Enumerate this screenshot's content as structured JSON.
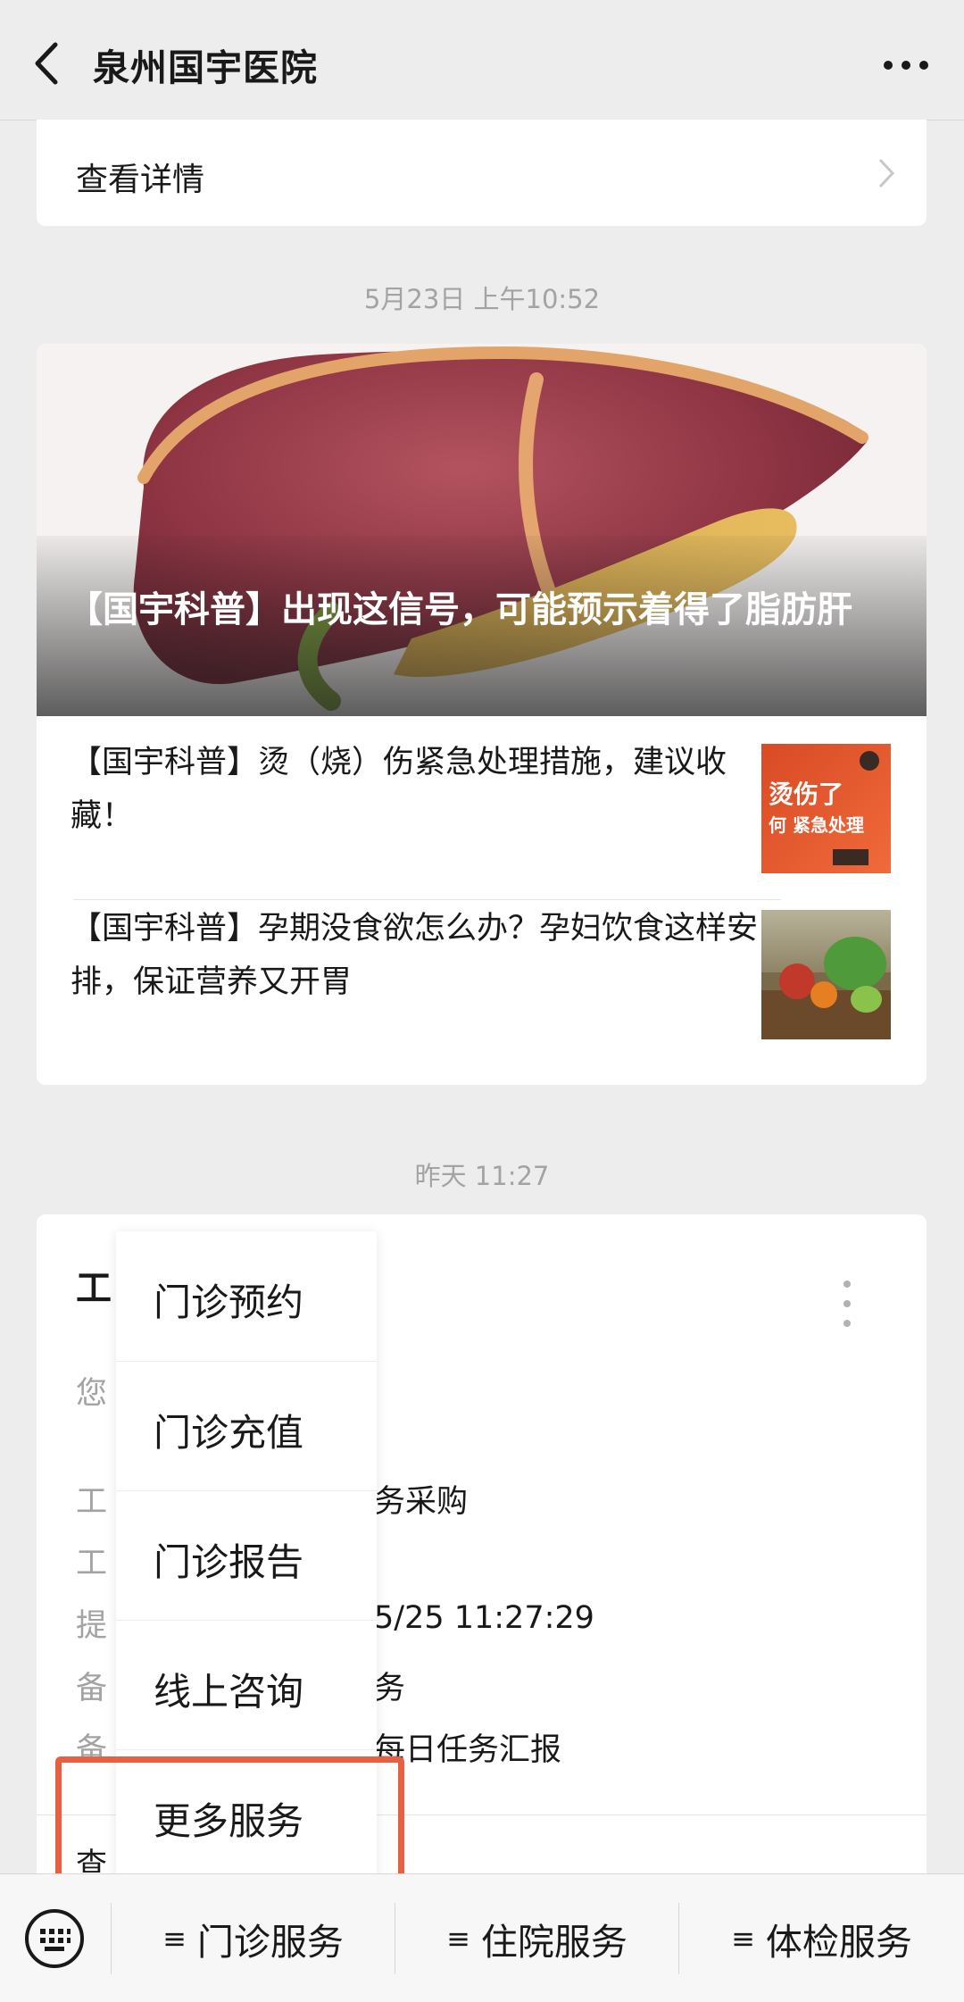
{
  "header": {
    "title": "泉州国宇医院",
    "back_icon": "chevron-left-icon",
    "more_icon": "more-dots-icon"
  },
  "card1": {
    "label": "查看详情"
  },
  "timestamps": {
    "first": "5月23日 上午10:52",
    "second": "昨天 11:27"
  },
  "articles": {
    "hero_title": "【国宇科普】出现这信号，可能预示着得了脂肪肝",
    "items": [
      {
        "title": "【国宇科普】烫（烧）伤紧急处理措施，建议收藏！",
        "thumb_line1": "烫伤了",
        "thumb_line2": "何 紧急处理"
      },
      {
        "title": "【国宇科普】孕期没食欲怎么办？孕妇饮食这样安排，保证营养又开胃"
      }
    ]
  },
  "template_msg": {
    "head_visible": "工",
    "rows": [
      {
        "left": "您",
        "right": ""
      },
      {
        "left": "工",
        "right": "务采购"
      },
      {
        "left": "工",
        "right": ""
      },
      {
        "left": "提",
        "right": "5/25 11:27:29"
      },
      {
        "left": "备",
        "right": "务"
      },
      {
        "left": "备",
        "right": "每日任务汇报"
      }
    ],
    "foot": "查"
  },
  "popup_menu": {
    "items": [
      "门诊预约",
      "门诊充值",
      "门诊报告",
      "线上咨询",
      "更多服务"
    ],
    "highlighted": "更多服务"
  },
  "bottom_menu": {
    "keyboard_icon": "keyboard-icon",
    "tabs": [
      "门诊服务",
      "住院服务",
      "体检服务"
    ],
    "hamburger": "≡"
  },
  "colors": {
    "highlight": "#e8603f",
    "background": "#ededed"
  }
}
